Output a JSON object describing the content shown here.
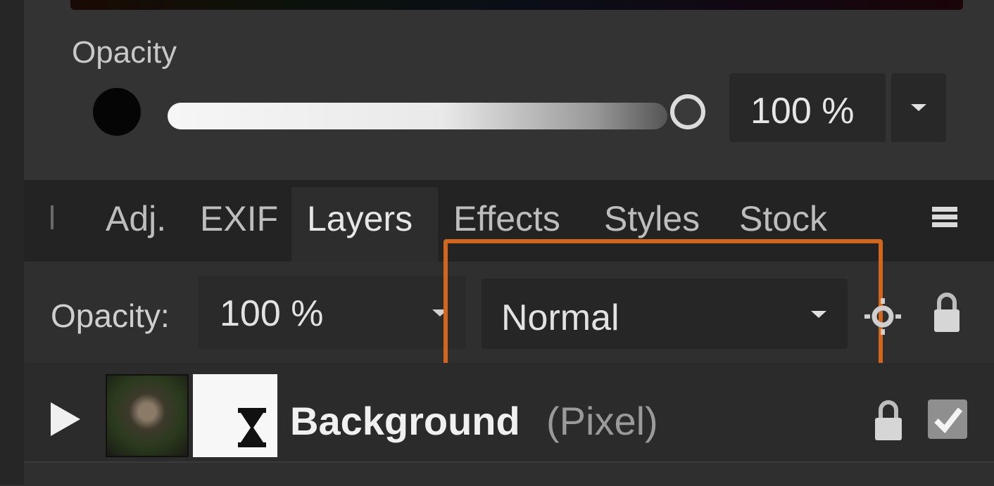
{
  "color_panel": {
    "opacity_label": "Opacity",
    "opacity_value": "100 %",
    "slider_level": 1.0
  },
  "tabs": [
    {
      "label": "Adj."
    },
    {
      "label": "EXIF"
    },
    {
      "label": "Layers",
      "active": true
    },
    {
      "label": "Effects"
    },
    {
      "label": "Styles"
    },
    {
      "label": "Stock"
    }
  ],
  "layer_toolbar": {
    "opacity_label": "Opacity:",
    "opacity_value": "100 %",
    "blend_mode": "Normal"
  },
  "layer": {
    "name": "Background",
    "type": "(Pixel)",
    "visible": true
  },
  "colors": {
    "highlight": "#d2661c",
    "panel_bg": "#2f2f2f"
  },
  "icons": [
    "menu-icon",
    "sun-icon",
    "lock-icon",
    "expand-icon",
    "hourglass-icon",
    "checkbox-icon"
  ]
}
